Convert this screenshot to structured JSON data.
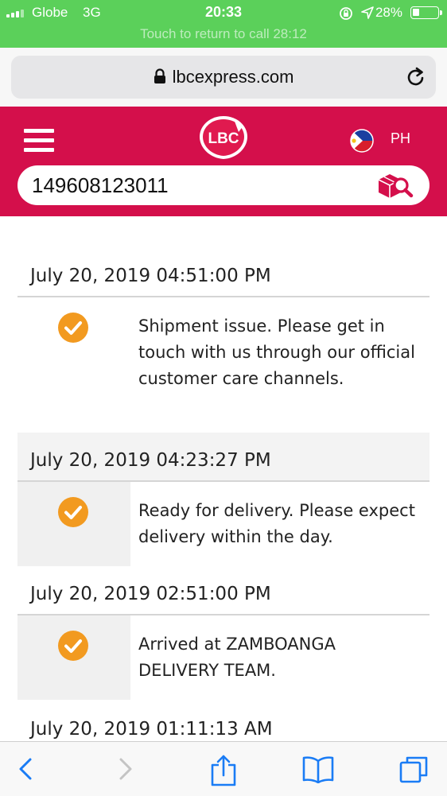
{
  "status_bar": {
    "carrier": "Globe",
    "network": "3G",
    "time": "20:33",
    "battery_percent": "28%",
    "battery_level": 0.28,
    "call_banner": "Touch to return to call 28:12"
  },
  "browser": {
    "url": "lbcexpress.com",
    "icons": {
      "lock": "padlock-icon",
      "reload": "reload-icon"
    }
  },
  "header": {
    "logo_text": "LBC",
    "country_code": "PH",
    "brand_color": "#d40f4b",
    "search": {
      "value": "149608123011",
      "placeholder": ""
    }
  },
  "tracking": {
    "check_color": "#f29a20",
    "events": [
      {
        "datetime": "July 20, 2019 04:51:00 PM",
        "status": "Shipment issue. Please get in touch with us through our official customer care channels."
      },
      {
        "datetime": "July 20, 2019 04:23:27 PM",
        "status": "Ready for delivery. Please expect delivery within the day."
      },
      {
        "datetime": "July 20, 2019 02:51:00 PM",
        "status": "Arrived at ZAMBOANGA DELIVERY TEAM."
      },
      {
        "datetime": "July 20, 2019 01:11:13 AM",
        "status": ""
      }
    ]
  },
  "toolbar": {
    "items": [
      "back-icon",
      "forward-icon",
      "share-icon",
      "bookmarks-icon",
      "tabs-icon"
    ]
  }
}
